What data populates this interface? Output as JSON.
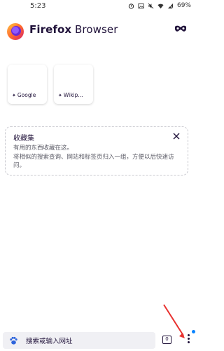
{
  "status_bar": {
    "time": "5:23",
    "battery": "69%"
  },
  "header": {
    "brand_prefix": "Firefox",
    "brand_suffix": "Browser"
  },
  "top_sites": [
    {
      "label": "Google"
    },
    {
      "label": "Wikip..."
    }
  ],
  "collections": {
    "title": "收藏集",
    "line1": "有用的东西收藏在这。",
    "line2": "将相似的搜索查询、网站和标签页归入一组，方便以后快速访问。"
  },
  "toolbar": {
    "search_placeholder": "搜索或输入网址",
    "tab_count": "0"
  },
  "colors": {
    "accent": "#0a84ff",
    "annotation": "#e8312f"
  }
}
